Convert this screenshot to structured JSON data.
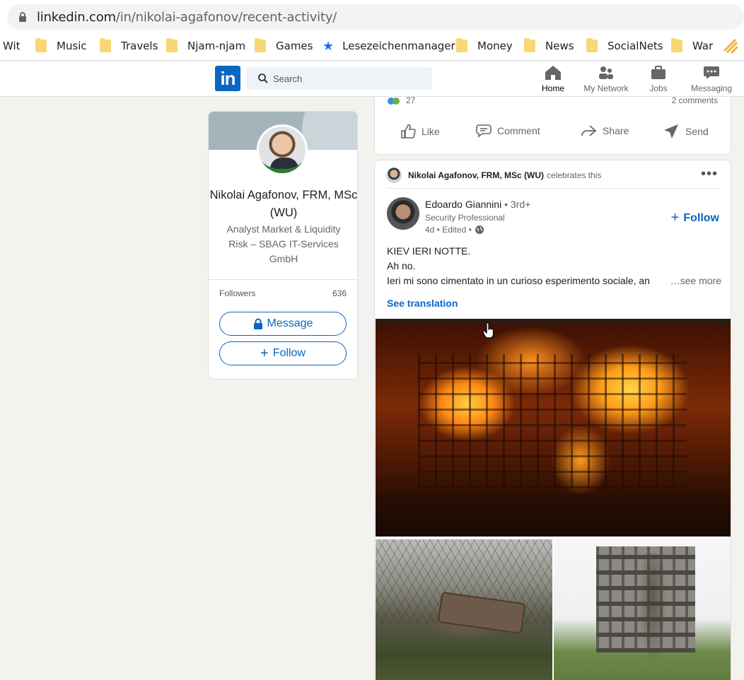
{
  "browser": {
    "url_host": "linkedin.com",
    "url_path": "/in/nikolai-agafonov/recent-activity/",
    "bookmarks": [
      {
        "label": "Wit",
        "icon": "none"
      },
      {
        "label": "Music",
        "icon": "folder-icon"
      },
      {
        "label": "Travels",
        "icon": "folder-icon"
      },
      {
        "label": "Njam-njam",
        "icon": "folder-icon"
      },
      {
        "label": "Games",
        "icon": "folder-icon"
      },
      {
        "label": "Lesezeichenmanager",
        "icon": "star-icon"
      },
      {
        "label": "Money",
        "icon": "folder-icon"
      },
      {
        "label": "News",
        "icon": "folder-icon"
      },
      {
        "label": "SocialNets",
        "icon": "folder-icon"
      },
      {
        "label": "War",
        "icon": "folder-icon"
      }
    ]
  },
  "header": {
    "logo": "in",
    "search_placeholder": "Search",
    "nav": [
      {
        "label": "Home",
        "icon": "home-icon",
        "active": true
      },
      {
        "label": "My Network",
        "icon": "network-icon",
        "active": false
      },
      {
        "label": "Jobs",
        "icon": "briefcase-icon",
        "active": false
      },
      {
        "label": "Messaging",
        "icon": "messaging-icon",
        "active": false
      }
    ]
  },
  "profile": {
    "name": "Nikolai Agafonov, FRM, MSc (WU)",
    "headline": "Analyst Market & Liquidity Risk – SBAG IT-Services GmbH",
    "followers_label": "Followers",
    "followers_count": "636",
    "message_label": "Message",
    "follow_label": "Follow"
  },
  "prev_post": {
    "reactions_count": "27",
    "comments": "2 comments",
    "actions": [
      "Like",
      "Comment",
      "Share",
      "Send"
    ]
  },
  "post": {
    "celebrator": "Nikolai Agafonov, FRM, MSc (WU)",
    "celebrates_text": "celebrates this",
    "author_name": "Edoardo Giannini",
    "author_degree": "• 3rd+",
    "author_headline": "Security Professional",
    "author_time": "4d • Edited •",
    "follow_label": "Follow",
    "text_line1": "KIEV IERI NOTTE.",
    "text_line2": "Ah no.",
    "text_line3": "Ieri mi sono cimentato in un curioso esperimento sociale, an",
    "see_more": "…see more",
    "see_translation": "See translation"
  },
  "colors": {
    "linkedin_blue": "#0a66c2",
    "page_bg": "#f3f2ef"
  }
}
